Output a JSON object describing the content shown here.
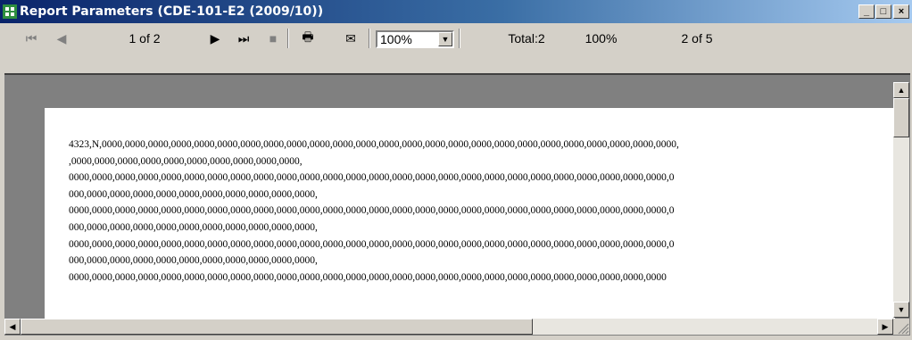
{
  "window": {
    "title": "Report Parameters (CDE-101-E2 (2009/10))"
  },
  "toolbar": {
    "page_indicator": "1 of 2",
    "zoom_value": "100%",
    "total_label": "Total:2",
    "percent_label": "100%",
    "pages_label": "2 of 5"
  },
  "icons": {
    "first": "⏮",
    "prev": "◀",
    "next": "▶",
    "last": "⏭",
    "stop": "■",
    "print": "🖶",
    "export": "✉"
  },
  "report": {
    "lines": [
      "4323,N,0000,0000,0000,0000,0000,0000,0000,0000,0000,0000,0000,0000,0000,0000,0000,0000,0000,0000,0000,0000,0000,0000,0000,0000,0000,",
      ",0000,0000,0000,0000,0000,0000,0000,0000,0000,0000,",
      "0000,0000,0000,0000,0000,0000,0000,0000,0000,0000,0000,0000,0000,0000,0000,0000,0000,0000,0000,0000,0000,0000,0000,0000,0000,0000,0",
      "000,0000,0000,0000,0000,0000,0000,0000,0000,0000,0000,",
      "0000,0000,0000,0000,0000,0000,0000,0000,0000,0000,0000,0000,0000,0000,0000,0000,0000,0000,0000,0000,0000,0000,0000,0000,0000,0000,0",
      "000,0000,0000,0000,0000,0000,0000,0000,0000,0000,0000,",
      "0000,0000,0000,0000,0000,0000,0000,0000,0000,0000,0000,0000,0000,0000,0000,0000,0000,0000,0000,0000,0000,0000,0000,0000,0000,0000,0",
      "000,0000,0000,0000,0000,0000,0000,0000,0000,0000,0000,",
      "0000,0000,0000,0000,0000,0000,0000,0000,0000,0000,0000,0000,0000,0000,0000,0000,0000,0000,0000,0000,0000,0000,0000,0000,0000,0000"
    ]
  }
}
